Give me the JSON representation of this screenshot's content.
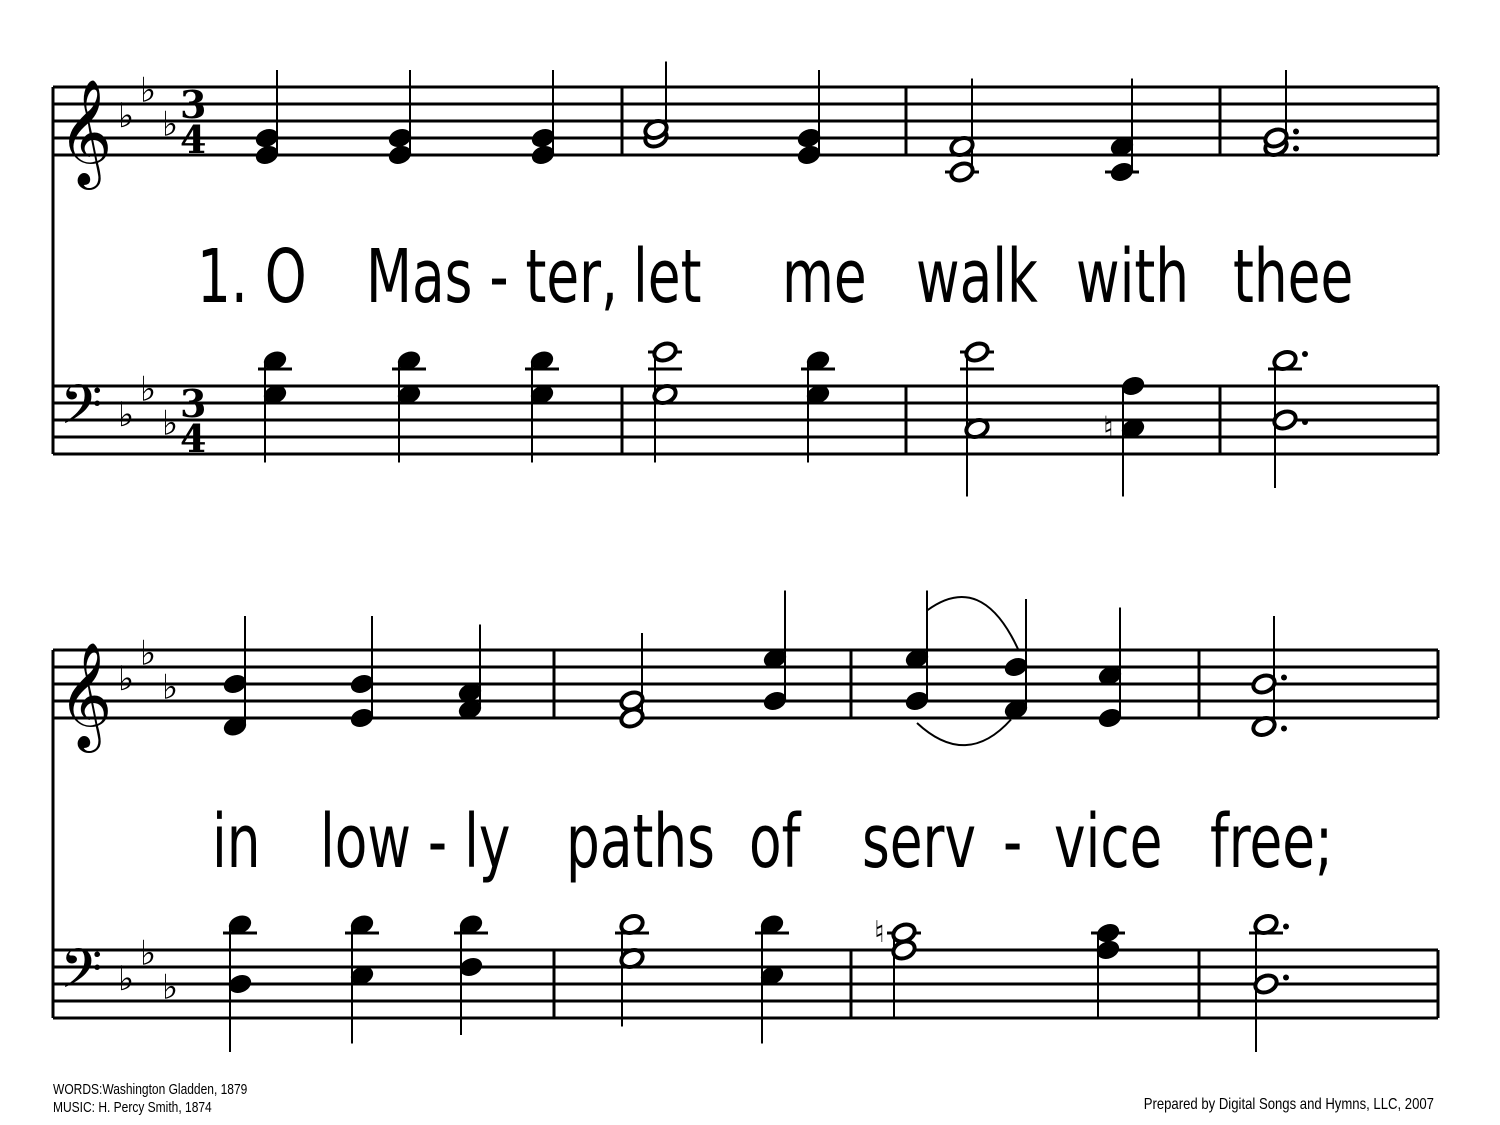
{
  "hymn": {
    "key_signature": "E-flat major (3 flats)",
    "time_signature": {
      "top": "3",
      "bottom": "4"
    },
    "systems": [
      {
        "lyrics": [
          {
            "text": "1. O"
          },
          {
            "text": "Mas - ter,"
          },
          {
            "text": "let"
          },
          {
            "text": "me"
          },
          {
            "text": "walk"
          },
          {
            "text": "with"
          },
          {
            "text": "thee"
          }
        ],
        "treble": [
          {
            "notes": [
              [
                "E4",
                "q"
              ],
              [
                "G4",
                "q"
              ]
            ],
            "stem": "up"
          },
          {
            "notes": [
              [
                "E4",
                "q"
              ],
              [
                "G4",
                "q"
              ]
            ],
            "stem": "up"
          },
          {
            "notes": [
              [
                "E4",
                "q"
              ],
              [
                "G4",
                "q"
              ]
            ],
            "stem": "up"
          },
          {
            "bar": true
          },
          {
            "notes": [
              [
                "G4",
                "h"
              ],
              [
                "Ab4",
                "h"
              ]
            ],
            "stem": "up"
          },
          {
            "notes": [
              [
                "E4",
                "q"
              ],
              [
                "G4",
                "q"
              ]
            ],
            "stem": "up"
          },
          {
            "bar": true
          },
          {
            "notes": [
              [
                "C4",
                "h"
              ],
              [
                "F4",
                "h"
              ]
            ],
            "stem": "up"
          },
          {
            "notes": [
              [
                "C4",
                "q"
              ],
              [
                "F4",
                "q"
              ]
            ],
            "stem": "up"
          },
          {
            "bar": true
          },
          {
            "notes": [
              [
                "F4",
                "hd"
              ],
              [
                "G4",
                "hd"
              ]
            ],
            "stem": "up"
          }
        ],
        "bass": [
          {
            "notes": [
              [
                "Eb3",
                "q"
              ],
              [
                "Bb3",
                "q"
              ]
            ],
            "stem": "down"
          },
          {
            "notes": [
              [
                "Eb3",
                "q"
              ],
              [
                "Bb3",
                "q"
              ]
            ],
            "stem": "down"
          },
          {
            "notes": [
              [
                "Eb3",
                "q"
              ],
              [
                "Bb3",
                "q"
              ]
            ],
            "stem": "down"
          },
          {
            "bar": true
          },
          {
            "notes": [
              [
                "Eb3",
                "h"
              ],
              [
                "C4",
                "h"
              ]
            ],
            "stem": "down"
          },
          {
            "notes": [
              [
                "Eb3",
                "q"
              ],
              [
                "Bb3",
                "q"
              ]
            ],
            "stem": "down"
          },
          {
            "bar": true
          },
          {
            "notes": [
              [
                "Ab2",
                "h"
              ],
              [
                "C4",
                "h"
              ]
            ],
            "stem": "down"
          },
          {
            "notes": [
              [
                "A2",
                "q"
              ],
              [
                "F3",
                "q"
              ]
            ],
            "stem": "down",
            "natural": "A2"
          },
          {
            "bar": true
          },
          {
            "notes": [
              [
                "Bb2",
                "hd"
              ],
              [
                "Bb3",
                "hd"
              ]
            ],
            "stem": "down"
          }
        ]
      },
      {
        "lyrics": [
          {
            "text": "in"
          },
          {
            "text": "low - ly"
          },
          {
            "text": "paths"
          },
          {
            "text": "of"
          },
          {
            "text": "serv"
          },
          {
            "text": "-"
          },
          {
            "text": "vice"
          },
          {
            "text": "free;"
          }
        ],
        "treble": [
          {
            "notes": [
              [
                "D4",
                "q"
              ],
              [
                "Bb4",
                "q"
              ]
            ],
            "stem": "up"
          },
          {
            "notes": [
              [
                "Eb4",
                "q"
              ],
              [
                "Bb4",
                "q"
              ]
            ],
            "stem": "up"
          },
          {
            "notes": [
              [
                "F4",
                "q"
              ],
              [
                "Ab4",
                "q"
              ]
            ],
            "stem": "up"
          },
          {
            "bar": true
          },
          {
            "notes": [
              [
                "Eb4",
                "h"
              ],
              [
                "G4",
                "h"
              ]
            ],
            "stem": "up"
          },
          {
            "notes": [
              [
                "G4",
                "q"
              ],
              [
                "Eb5",
                "q"
              ]
            ],
            "stem": "up"
          },
          {
            "bar": true
          },
          {
            "notes": [
              [
                "G4",
                "q"
              ],
              [
                "Eb5",
                "q"
              ]
            ],
            "stem": "up",
            "slur_start": true
          },
          {
            "notes": [
              [
                "F4",
                "q"
              ],
              [
                "D5",
                "q"
              ]
            ],
            "stem": "up",
            "slur_end": true
          },
          {
            "notes": [
              [
                "Eb4",
                "q"
              ],
              [
                "C5",
                "q"
              ]
            ],
            "stem": "up"
          },
          {
            "bar": true
          },
          {
            "notes": [
              [
                "D4",
                "hd"
              ],
              [
                "Bb4",
                "hd"
              ]
            ],
            "stem": "up"
          }
        ],
        "bass": [
          {
            "notes": [
              [
                "Bb2",
                "q"
              ],
              [
                "Bb3",
                "q"
              ]
            ],
            "stem": "down"
          },
          {
            "notes": [
              [
                "C3",
                "q"
              ],
              [
                "Bb3",
                "q"
              ]
            ],
            "stem": "down"
          },
          {
            "notes": [
              [
                "D3",
                "q"
              ],
              [
                "Bb3",
                "q"
              ]
            ],
            "stem": "down"
          },
          {
            "bar": true
          },
          {
            "notes": [
              [
                "Eb3",
                "h"
              ],
              [
                "Bb3",
                "h"
              ]
            ],
            "stem": "down"
          },
          {
            "notes": [
              [
                "C3",
                "q"
              ],
              [
                "Bb3",
                "q"
              ]
            ],
            "stem": "down"
          },
          {
            "bar": true
          },
          {
            "notes": [
              [
                "F3",
                "h"
              ],
              [
                "A3",
                "h"
              ]
            ],
            "stem": "down",
            "natural": "A3"
          },
          {
            "notes": [
              [
                "F3",
                "q"
              ],
              [
                "A3",
                "q"
              ]
            ],
            "stem": "down"
          },
          {
            "bar": true
          },
          {
            "notes": [
              [
                "Bb2",
                "hd"
              ],
              [
                "Bb3",
                "hd"
              ]
            ],
            "stem": "down"
          }
        ]
      }
    ]
  },
  "credits": {
    "words": "WORDS:Washington Gladden, 1879",
    "music": "MUSIC: H. Percy Smith, 1874",
    "prepared_by": "Prepared by Digital Songs and Hymns, LLC, 2007"
  }
}
